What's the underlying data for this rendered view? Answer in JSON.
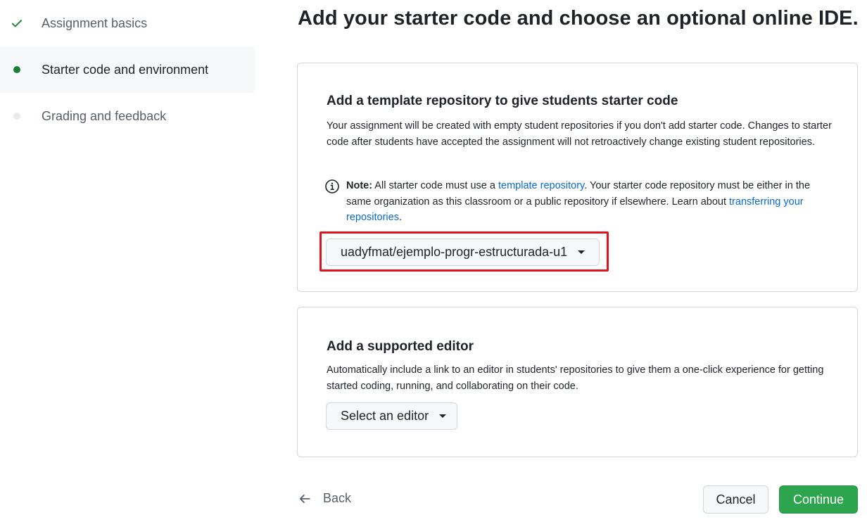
{
  "sidebar": {
    "steps": [
      {
        "label": "Assignment basics",
        "state": "done"
      },
      {
        "label": "Starter code and environment",
        "state": "current"
      },
      {
        "label": "Grading and feedback",
        "state": "upcoming"
      }
    ]
  },
  "page_title": "Add your starter code and choose an optional online IDE.",
  "template_section": {
    "heading": "Add a template repository to give students starter code",
    "description": "Your assignment will be created with empty student repositories if you don't add starter code. Changes to starter code after students have accepted the assignment will not retroactively change existing student repositories.",
    "note_label": "Note:",
    "note_text_1": "All starter code must use a",
    "note_link_1": "template repository",
    "note_text_2": ". Your starter code repository must be either in the same organization as this classroom or a public repository if elsewhere. Learn about",
    "note_link_2": "transferring your repositories",
    "note_text_3": ".",
    "selected_repository": "uadyfmat/ejemplo-progr-estructurada-u1"
  },
  "editor_section": {
    "heading": "Add a supported editor",
    "description": "Automatically include a link to an editor in students' repositories to give them a one-click experience for getting started coding, running, and collaborating on their code.",
    "select_label": "Select an editor"
  },
  "footer": {
    "back_label": "Back",
    "cancel_label": "Cancel",
    "continue_label": "Continue"
  },
  "colors": {
    "accent_green": "#2da44e",
    "link_blue": "#0969da",
    "highlight_red": "#e0141e"
  }
}
